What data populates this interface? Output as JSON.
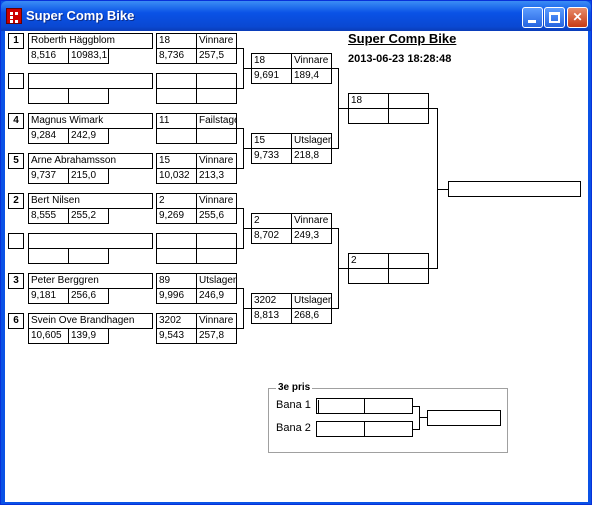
{
  "window": {
    "title": "Super Comp Bike",
    "minimize_icon": "minimize-icon",
    "maximize_icon": "maximize-icon",
    "close_icon": "close-icon",
    "close_glyph": "✕"
  },
  "header": {
    "title": "Super Comp Bike",
    "datetime": "2013-06-23 18:28:48"
  },
  "round1": [
    {
      "seed": "1",
      "name": "Roberth Häggblom",
      "time": "8,516",
      "speed": "10983,1",
      "res_num": "18",
      "res_status": "Vinnare",
      "res_time": "8,736",
      "res_speed": "257,5"
    },
    {
      "seed": "",
      "name": "",
      "time": "",
      "speed": "",
      "res_num": "",
      "res_status": "",
      "res_time": "",
      "res_speed": ""
    },
    {
      "seed": "4",
      "name": "Magnus Wimark",
      "time": "9,284",
      "speed": "242,9",
      "res_num": "11",
      "res_status": "Failstage",
      "res_time": "",
      "res_speed": ""
    },
    {
      "seed": "5",
      "name": "Arne Abrahamsson",
      "time": "9,737",
      "speed": "215,0",
      "res_num": "15",
      "res_status": "Vinnare",
      "res_time": "10,032",
      "res_speed": "213,3"
    },
    {
      "seed": "2",
      "name": "Bert Nilsen",
      "time": "8,555",
      "speed": "255,2",
      "res_num": "2",
      "res_status": "Vinnare",
      "res_time": "9,269",
      "res_speed": "255,6"
    },
    {
      "seed": "",
      "name": "",
      "time": "",
      "speed": "",
      "res_num": "",
      "res_status": "",
      "res_time": "",
      "res_speed": ""
    },
    {
      "seed": "3",
      "name": "Peter Berggren",
      "time": "9,181",
      "speed": "256,6",
      "res_num": "89",
      "res_status": "Utslagen",
      "res_time": "9,996",
      "res_speed": "246,9"
    },
    {
      "seed": "6",
      "name": "Svein Ove Brandhagen",
      "time": "10,605",
      "speed": "139,9",
      "res_num": "3202",
      "res_status": "Vinnare",
      "res_time": "9,543",
      "res_speed": "257,8"
    }
  ],
  "round2": [
    {
      "num": "18",
      "status": "Vinnare",
      "time": "9,691",
      "speed": "189,4"
    },
    {
      "num": "15",
      "status": "Utslagen",
      "time": "9,733",
      "speed": "218,8"
    },
    {
      "num": "2",
      "status": "Vinnare",
      "time": "8,702",
      "speed": "249,3"
    },
    {
      "num": "3202",
      "status": "Utslagen",
      "time": "8,813",
      "speed": "268,6"
    }
  ],
  "semis": [
    {
      "num": "18",
      "status": "",
      "time": "",
      "speed": ""
    },
    {
      "num": "2",
      "status": "",
      "time": "",
      "speed": ""
    }
  ],
  "final": {
    "value": ""
  },
  "bronze": {
    "legend": "3e pris",
    "lane1_label": "Bana 1",
    "lane2_label": "Bana 2",
    "lane1_a": "",
    "lane1_b": "",
    "lane2_a": "",
    "lane2_b": "",
    "result": ""
  }
}
